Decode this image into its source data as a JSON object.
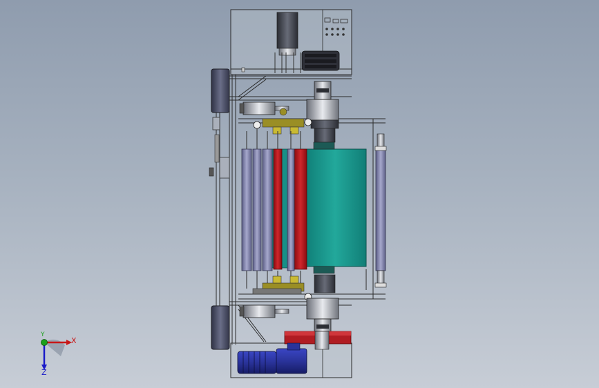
{
  "viewport": {
    "name": "cad-3d-viewport",
    "model": "roller-machine-assembly"
  },
  "triad": {
    "x_label": "X",
    "y_label": "Y",
    "z_label": "Z"
  },
  "colors": {
    "background_top": "#8f9cae",
    "background_bottom": "#c7cdd6",
    "frame_line": "#2b2b2b",
    "teal_drum": "#1a9a8f",
    "red_roller": "#b5141a",
    "purple_roller": "#7f80a8",
    "motor_blue": "#2a35a8",
    "gear_yellow": "#b8a92a",
    "side_plate": "#4c4f63",
    "axis_x": "#c81818",
    "axis_y": "#1aa01a",
    "axis_z": "#1a1ac8"
  }
}
